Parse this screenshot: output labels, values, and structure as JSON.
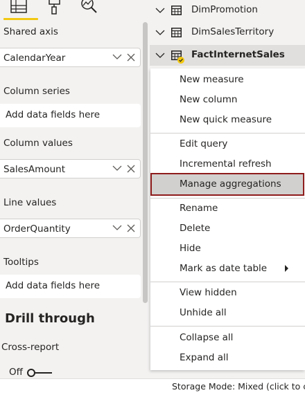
{
  "visualizations_pane": {
    "tabs": [
      {
        "icon": "fields-icon",
        "active": true
      },
      {
        "icon": "format-paint-roller-icon",
        "active": false
      },
      {
        "icon": "analytics-magnifier-icon",
        "active": false
      }
    ],
    "wells": [
      {
        "label": "Shared axis",
        "value": "CalendarYear"
      },
      {
        "label": "Column series",
        "placeholder": "Add data fields here"
      },
      {
        "label": "Column values",
        "value": "SalesAmount"
      },
      {
        "label": "Line values",
        "value": "OrderQuantity"
      },
      {
        "label": "Tooltips",
        "placeholder": "Add data fields here"
      }
    ],
    "drill_through": {
      "title": "Drill through",
      "cross_report_label": "Cross-report",
      "toggle_label": "Off",
      "toggle_on": false
    },
    "accent_color": "#f2c811"
  },
  "fields_pane": {
    "tables": [
      {
        "name": "DimPromotion",
        "expanded": false
      },
      {
        "name": "DimSalesTerritory",
        "expanded": false
      },
      {
        "name": "FactInternetSales",
        "expanded": true,
        "selected": true
      }
    ]
  },
  "context_menu": {
    "groups": [
      [
        "New measure",
        "New column",
        "New quick measure"
      ],
      [
        "Edit query",
        "Incremental refresh",
        "Manage aggregations"
      ],
      [
        "Rename",
        "Delete",
        "Hide",
        "Mark as date table"
      ],
      [
        "View hidden",
        "Unhide all"
      ],
      [
        "Collapse all",
        "Expand all"
      ]
    ],
    "highlighted_item": "Manage aggregations",
    "highlight_border_color": "#8e1b1b",
    "submenu_item": "Mark as date table"
  },
  "status_bar": {
    "text": "Storage Mode: Mixed (click to cl"
  }
}
